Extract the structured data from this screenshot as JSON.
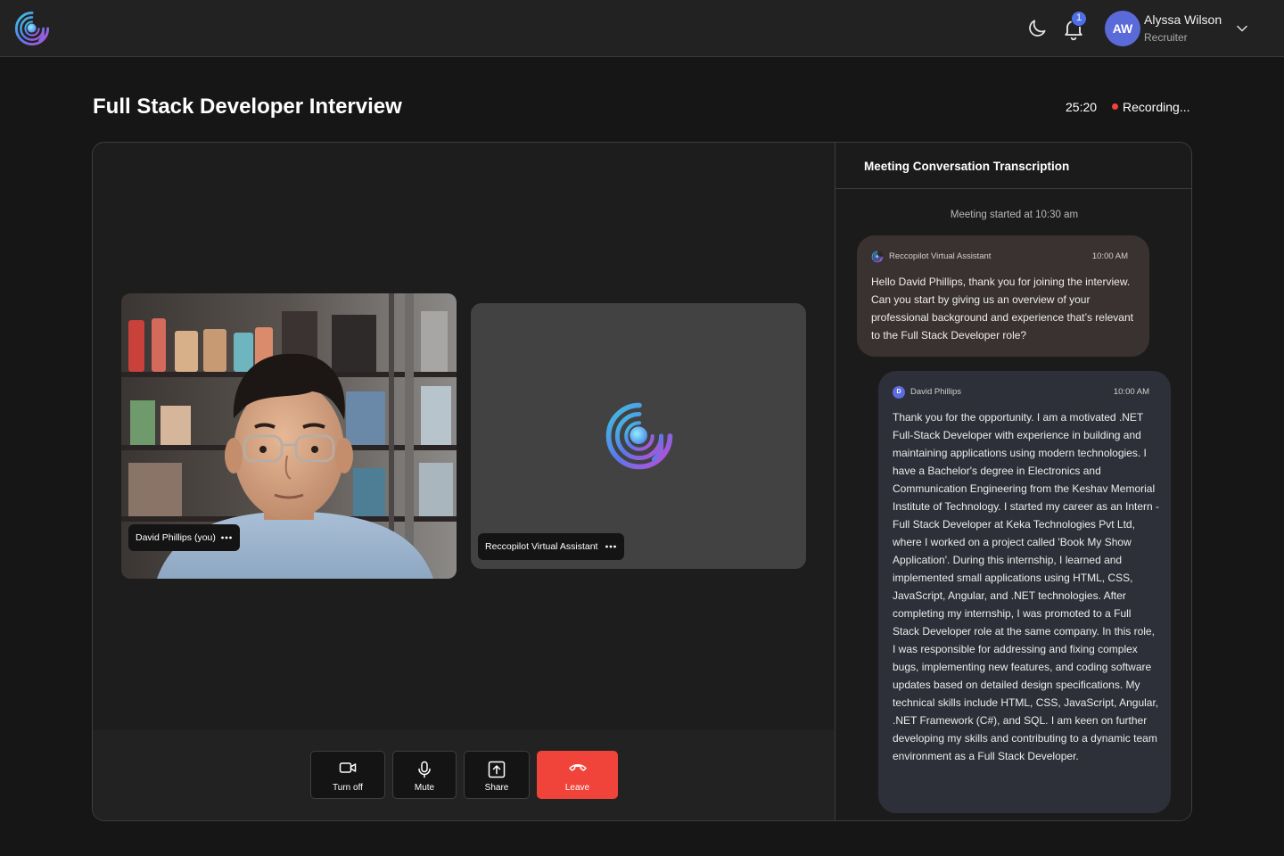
{
  "header": {
    "user": {
      "initials": "AW",
      "name": "Alyssa Wilson",
      "role": "Recruiter"
    },
    "notifications": {
      "count": "1"
    },
    "icons": {
      "theme": "moon-icon",
      "notifications": "bell-icon",
      "menu": "chevron-down-icon"
    }
  },
  "meeting": {
    "title": "Full Stack Developer Interview",
    "timer": "25:20",
    "recording_label": "Recording...",
    "participants": [
      {
        "name": "David Phillips (you)"
      },
      {
        "name": "Reccopilot Virtual Assistant"
      }
    ],
    "controls": {
      "video": "Turn off",
      "mute": "Mute",
      "share": "Share",
      "leave": "Leave"
    }
  },
  "transcript": {
    "title": "Meeting Conversation Transcription",
    "started": "Meeting started at 10:30 am",
    "messages": [
      {
        "sender": "Reccopilot Virtual Assistant",
        "time": "10:00 AM",
        "text": "Hello David Phillips, thank you for joining the interview. Can you start by giving us an overview of your professional background and experience that’s relevant to the Full Stack Developer role?"
      },
      {
        "sender": "David Phillips",
        "initial": "D",
        "time": "10:00 AM",
        "text": "Thank you for the opportunity. I am a motivated .NET Full-Stack Developer with experience in building and maintaining applications using modern technologies. I have a Bachelor's degree in Electronics and Communication Engineering from the Keshav Memorial Institute of Technology. I started my career as an Intern - Full Stack Developer at Keka Technologies Pvt Ltd, where I worked on a project called 'Book My Show Application'. During this internship, I learned and implemented small applications using HTML, CSS, JavaScript, Angular, and .NET technologies. After completing my internship, I was promoted to a Full Stack Developer role at the same company. In this role, I was responsible for addressing and fixing complex bugs, implementing new features, and coding software updates based on detailed design specifications. My technical skills include HTML, CSS, JavaScript, Angular, .NET Framework (C#), and SQL. I am keen on further developing my skills and contributing to a dynamic team environment as a Full Stack Developer."
      }
    ]
  },
  "colors": {
    "accent": "#5b6ad9",
    "recording": "#f0433a",
    "leave": "#f0433a",
    "assistant_bubble": "#3a3230",
    "user_bubble": "#2d3038"
  }
}
